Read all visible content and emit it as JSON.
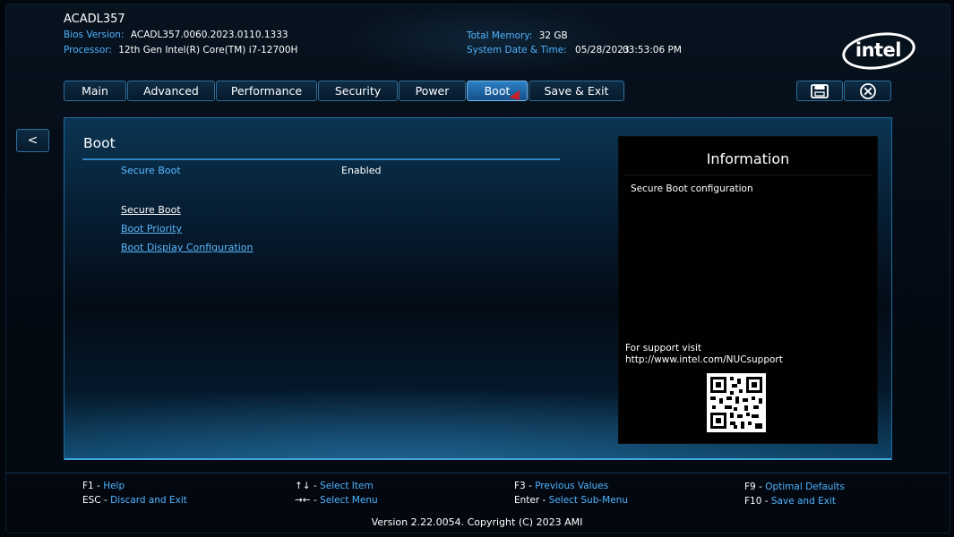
{
  "header": {
    "title": "ACADL357",
    "bios_version_label": "Bios Version:",
    "bios_version_value": "ACADL357.0060.2023.0110.1333",
    "processor_label": "Processor:",
    "processor_value": "12th Gen Intel(R) Core(TM) i7-12700H",
    "total_memory_label": "Total Memory:",
    "total_memory_value": "32 GB",
    "system_datetime_label": "System Date & Time:",
    "system_date_value": "05/28/2023",
    "system_time_value": "03:53:06 PM",
    "logo_text": "intel"
  },
  "tabs": [
    {
      "label": "Main"
    },
    {
      "label": "Advanced"
    },
    {
      "label": "Performance"
    },
    {
      "label": "Security"
    },
    {
      "label": "Power"
    },
    {
      "label": "Boot",
      "active": true
    },
    {
      "label": "Save & Exit"
    }
  ],
  "toolbar": {
    "save_icon": "floppy-disk-icon",
    "close_icon": "close-circle-icon"
  },
  "back_button": {
    "label": "<"
  },
  "main": {
    "section_title": "Boot",
    "settings": [
      {
        "label": "Secure Boot",
        "value": "Enabled"
      }
    ],
    "submenus": [
      {
        "label": "Secure Boot",
        "selected": true
      },
      {
        "label": "Boot Priority"
      },
      {
        "label": "Boot Display Configuration"
      }
    ]
  },
  "info_panel": {
    "title": "Information",
    "text": "Secure Boot configuration",
    "support_line1": "For support visit",
    "support_line2": "http://www.intel.com/NUCsupport",
    "qr_icon": "qr-code-icon"
  },
  "footer": {
    "f1_key": "F1",
    "f1_desc": "Help",
    "esc_key": "ESC",
    "esc_desc": "Discard and Exit",
    "updown_key": "↑↓",
    "updown_desc": "Select Item",
    "leftright_key": "→←",
    "leftright_desc": "Select Menu",
    "f3_key": "F3",
    "f3_desc": "Previous Values",
    "enter_key": "Enter",
    "enter_desc": "Select Sub-Menu",
    "f9_key": "F9",
    "f9_desc": "Optimal Defaults",
    "f10_key": "F10",
    "f10_desc": "Save and Exit",
    "separator": " - ",
    "version": "Version 2.22.0054. Copyright (C) 2023 AMI"
  },
  "colors": {
    "accent_blue": "#4fb3ff",
    "active_tab": "#2c7fc4",
    "background": "#02060d",
    "cursor_red": "#c71f2a"
  }
}
